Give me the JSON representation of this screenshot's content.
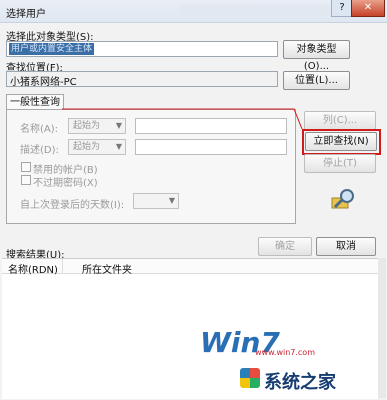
{
  "window": {
    "title": "选择用户",
    "help_label": "?",
    "close_label": "✕"
  },
  "object_type": {
    "label": "选择此对象类型(S):",
    "value": "用户或内置安全主体",
    "button": "对象类型(O)..."
  },
  "location": {
    "label": "查找位置(F):",
    "value": "小猪系网络-PC",
    "button": "位置(L)..."
  },
  "tabs": [
    {
      "label": "一般性查询"
    }
  ],
  "general_query": {
    "name_label": "名称(A):",
    "name_mode": "起始为",
    "desc_label": "描述(D):",
    "desc_mode": "起始为",
    "disabled_accounts": "禁用的帐户(B)",
    "no_expire_pwd": "不过期密码(X)",
    "days_label": "自上次登录后的天数(I):"
  },
  "side_buttons": {
    "columns": "列(C)...",
    "find_now": "立即查找(N)",
    "stop": "停止(T)"
  },
  "search_icon": "search-magnifier-icon",
  "results": {
    "label": "搜索结果(U):",
    "ok": "确定",
    "cancel": "取消",
    "columns": [
      "名称(RDN)",
      "所在文件夹"
    ]
  },
  "watermark": {
    "logo": "Win7",
    "text": "系统之家",
    "url": "www.win7.com"
  },
  "colors": {
    "highlight": "#d11a1a",
    "selection": "#3a6ea5"
  }
}
